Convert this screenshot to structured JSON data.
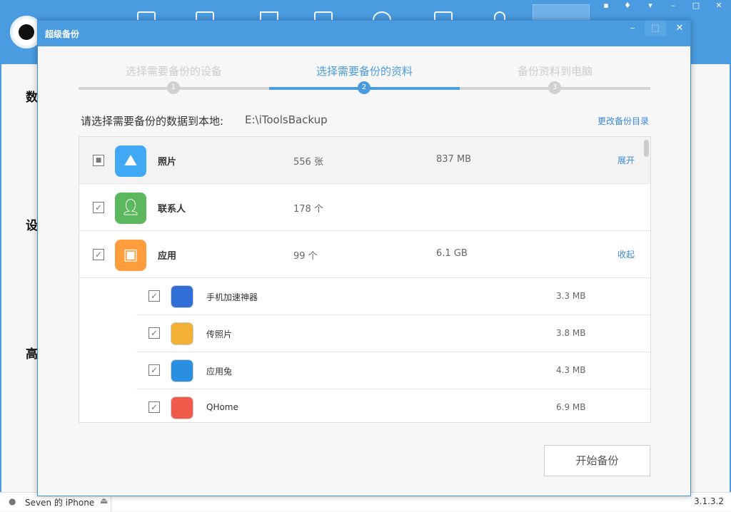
{
  "background": {
    "sections": [
      "数",
      "设",
      "高"
    ],
    "version": "3.1.3.2",
    "device": "Seven 的 iPhone"
  },
  "dialog": {
    "title": "超级备份",
    "steps": [
      {
        "label": "选择需要备份的设备",
        "num": "1"
      },
      {
        "label": "选择需要备份的资料",
        "num": "2"
      },
      {
        "label": "备份资料到电脑",
        "num": "3"
      }
    ],
    "active_step": 2,
    "path_label": "请选择需要备份的数据到本地:",
    "path": "E:\\iToolsBackup",
    "change_dir": "更改备份目录",
    "categories": [
      {
        "name": "照片",
        "count": "556 张",
        "size": "837 MB",
        "action": "展开",
        "state": "partial",
        "icon": "image-icon",
        "color": "#3fa9f5"
      },
      {
        "name": "联系人",
        "count": "178 个",
        "size": "",
        "action": "",
        "state": "checked",
        "icon": "person-icon",
        "color": "#5cb85c"
      },
      {
        "name": "应用",
        "count": "99 个",
        "size": "6.1 GB",
        "action": "收起",
        "state": "checked",
        "icon": "apps-icon",
        "color": "#ff9c3c"
      }
    ],
    "apps": [
      {
        "name": "手机加速神器",
        "size": "3.3 MB",
        "color": "#2f6fd6"
      },
      {
        "name": "传照片",
        "size": "3.8 MB",
        "color": "#f2b134"
      },
      {
        "name": "应用兔",
        "size": "4.3 MB",
        "color": "#2a8fe0"
      },
      {
        "name": "QHome",
        "size": "6.9 MB",
        "color": "#ef5a4a"
      }
    ],
    "start_button": "开始备份"
  }
}
